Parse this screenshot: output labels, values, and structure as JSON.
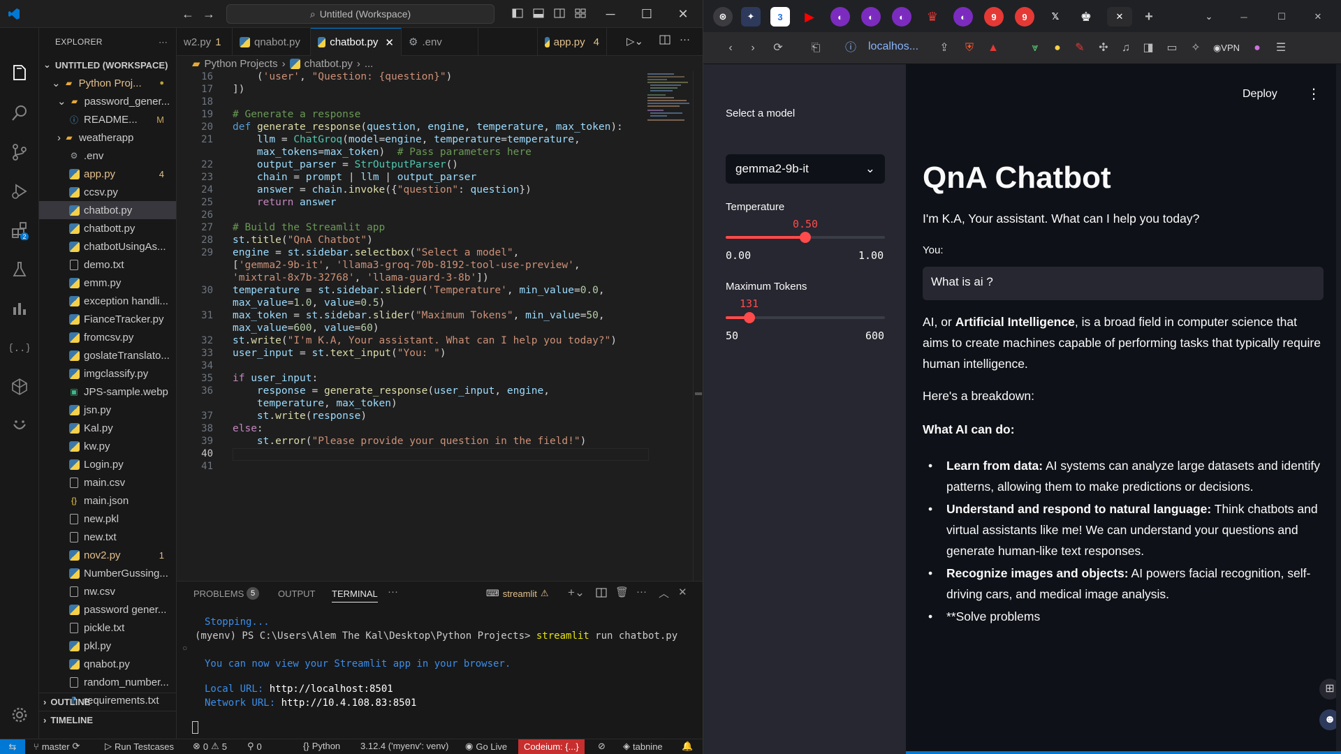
{
  "vscode": {
    "title": "Untitled (Workspace)",
    "explorer": {
      "header": "EXPLORER",
      "workspace": "UNTITLED (WORKSPACE)",
      "root": "Python Proj...",
      "items": [
        {
          "label": "password_gener...",
          "type": "folder",
          "status": "",
          "color": "#cccccc"
        },
        {
          "label": "README...",
          "type": "info",
          "status": "M",
          "color": "#cccccc"
        },
        {
          "label": "weatherapp",
          "type": "folder",
          "status": "",
          "color": "#cccccc"
        },
        {
          "label": ".env",
          "type": "gear",
          "status": "",
          "color": "#cccccc"
        },
        {
          "label": "app.py",
          "type": "py",
          "status": "4",
          "color": "#e2c08d"
        },
        {
          "label": "ccsv.py",
          "type": "py",
          "status": "",
          "color": "#cccccc"
        },
        {
          "label": "chatbot.py",
          "type": "py",
          "status": "",
          "color": "#cccccc"
        },
        {
          "label": "chatbott.py",
          "type": "py",
          "status": "",
          "color": "#cccccc"
        },
        {
          "label": "chatbotUsingAs...",
          "type": "py",
          "status": "",
          "color": "#cccccc"
        },
        {
          "label": "demo.txt",
          "type": "txt",
          "status": "",
          "color": "#cccccc"
        },
        {
          "label": "emm.py",
          "type": "py",
          "status": "",
          "color": "#cccccc"
        },
        {
          "label": "exception handli...",
          "type": "py",
          "status": "",
          "color": "#cccccc"
        },
        {
          "label": "FianceTracker.py",
          "type": "py",
          "status": "",
          "color": "#cccccc"
        },
        {
          "label": "fromcsv.py",
          "type": "py",
          "status": "",
          "color": "#cccccc"
        },
        {
          "label": "goslateTranslato...",
          "type": "py",
          "status": "",
          "color": "#cccccc"
        },
        {
          "label": "imgclassify.py",
          "type": "py",
          "status": "",
          "color": "#cccccc"
        },
        {
          "label": "JPS-sample.webp",
          "type": "img",
          "status": "",
          "color": "#cccccc"
        },
        {
          "label": "jsn.py",
          "type": "py",
          "status": "",
          "color": "#cccccc"
        },
        {
          "label": "Kal.py",
          "type": "py",
          "status": "",
          "color": "#cccccc"
        },
        {
          "label": "kw.py",
          "type": "py",
          "status": "",
          "color": "#cccccc"
        },
        {
          "label": "Login.py",
          "type": "py",
          "status": "",
          "color": "#cccccc"
        },
        {
          "label": "main.csv",
          "type": "txt",
          "status": "",
          "color": "#cccccc"
        },
        {
          "label": "main.json",
          "type": "json",
          "status": "",
          "color": "#cccccc"
        },
        {
          "label": "new.pkl",
          "type": "txt",
          "status": "",
          "color": "#cccccc"
        },
        {
          "label": "new.txt",
          "type": "txt",
          "status": "",
          "color": "#cccccc"
        },
        {
          "label": "nov2.py",
          "type": "py",
          "status": "1",
          "color": "#e2c08d"
        },
        {
          "label": "NumberGussing...",
          "type": "py",
          "status": "",
          "color": "#cccccc"
        },
        {
          "label": "nw.csv",
          "type": "txt",
          "status": "",
          "color": "#cccccc"
        },
        {
          "label": "password gener...",
          "type": "py",
          "status": "",
          "color": "#cccccc"
        },
        {
          "label": "pickle.txt",
          "type": "txt",
          "status": "",
          "color": "#cccccc"
        },
        {
          "label": "pkl.py",
          "type": "py",
          "status": "",
          "color": "#cccccc"
        },
        {
          "label": "qnabot.py",
          "type": "py",
          "status": "",
          "color": "#cccccc"
        },
        {
          "label": "random_number...",
          "type": "txt",
          "status": "",
          "color": "#cccccc"
        },
        {
          "label": "requirements.txt",
          "type": "req",
          "status": "",
          "color": "#cccccc"
        }
      ],
      "outline": "OUTLINE",
      "timeline": "TIMELINE"
    },
    "tabs": [
      {
        "label": "w2.py",
        "badge": "1"
      },
      {
        "label": "qnabot.py",
        "badge": ""
      },
      {
        "label": "chatbot.py",
        "badge": ""
      },
      {
        "label": ".env",
        "badge": ""
      },
      {
        "label": "app.py",
        "badge": "4"
      }
    ],
    "breadcrumb": [
      "Python Projects",
      "chatbot.py",
      "..."
    ],
    "line_numbers": [
      "16",
      "17",
      "18",
      "19",
      "20",
      "21",
      "",
      "22",
      "23",
      "24",
      "25",
      "26",
      "27",
      "28",
      "29",
      "",
      "",
      "30",
      "",
      "31",
      "",
      "32",
      "33",
      "34",
      "35",
      "36",
      "",
      "37",
      "38",
      "39",
      "40",
      "41"
    ],
    "current_line": "40",
    "panel": {
      "tabs": [
        "PROBLEMS",
        "OUTPUT",
        "TERMINAL"
      ],
      "problems_count": "5",
      "terminal_name": "streamlit",
      "lines": {
        "stopping": "Stopping...",
        "prompt": "(myenv) PS C:\\Users\\Alem The Kal\\Desktop\\Python Projects> ",
        "command": "streamlit",
        "command_args": " run chatbot.py",
        "view_msg": "You can now view your Streamlit app in your browser.",
        "local_label": "Local URL: ",
        "local_url": "http://localhost:8501",
        "network_label": "Network URL: ",
        "network_url": "http://10.4.108.83:8501"
      }
    },
    "statusbar": {
      "branch": "master",
      "run_tests": "Run Testcases",
      "errors": "0",
      "warnings": "5",
      "ports": "0",
      "language": "Python",
      "interpreter": "3.12.4 ('myenv': venv)",
      "golive": "Go Live",
      "codeium": "Codeium: {...}",
      "tabnine": "tabnine"
    }
  },
  "browser": {
    "url": "localhos...",
    "vpn": "VPN",
    "tab_badges": [
      "3",
      "9",
      "9"
    ],
    "sidebar": {
      "model_label": "Select a model",
      "model_value": "gemma2-9b-it",
      "temp_label": "Temperature",
      "temp_value": "0.50",
      "temp_fraction": 0.5,
      "temp_min": "0.00",
      "temp_max": "1.00",
      "tokens_label": "Maximum Tokens",
      "tokens_value": "131",
      "tokens_fraction": 0.1473,
      "tokens_min": "50",
      "tokens_max": "600"
    },
    "main": {
      "deploy": "Deploy",
      "title": "QnA Chatbot",
      "intro": "I'm K.A, Your assistant. What can I help you today?",
      "input_label": "You:",
      "input_value": "What is ai ?",
      "para1_pre": "AI, or ",
      "para1_bold": "Artificial Intelligence",
      "para1_post": ", is a broad field in computer science that aims to create machines capable of performing tasks that typically require human intelligence.",
      "breakdown": "Here's a breakdown:",
      "what_ai": "What AI can do:",
      "bullets": [
        {
          "bold": "Learn from data:",
          "text": " AI systems can analyze large datasets and identify patterns, allowing them to make predictions or decisions."
        },
        {
          "bold": "Understand and respond to natural language:",
          "text": " Think chatbots and virtual assistants like me! We can understand your questions and generate human-like text responses."
        },
        {
          "bold": "Recognize images and objects:",
          "text": " AI powers facial recognition, self-driving cars, and medical image analysis."
        },
        {
          "bold": "",
          "text": "**Solve problems"
        }
      ]
    }
  }
}
